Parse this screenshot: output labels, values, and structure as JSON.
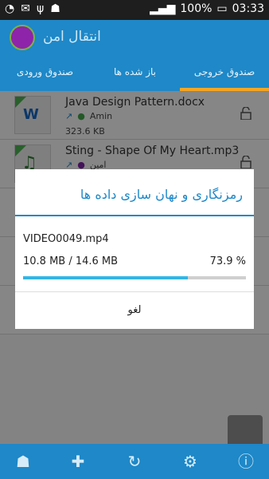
{
  "status_bar": {
    "battery": "100%",
    "time": "03:33"
  },
  "app": {
    "title": "انتقال امن"
  },
  "tabs": [
    {
      "label": "صندوق ورودی"
    },
    {
      "label": "باز شده ها"
    },
    {
      "label": "صندوق خروجی"
    }
  ],
  "files": [
    {
      "name": "Java Design Pattern.docx",
      "contact": "Amin",
      "size": "323.6 KB"
    },
    {
      "name": "Sting - Shape Of My Heart.mp3",
      "contact": "امین"
    }
  ],
  "dialog": {
    "title": "رمزنگاری و نهان سازی داده ها",
    "filename": "VIDEO0049.mp4",
    "sizes": "10.8 MB / 14.6 MB",
    "percent_text": "73.9 %",
    "progress": 0.739,
    "cancel_label": "لغو"
  },
  "bottom_bar": {
    "icons": [
      "android-icon",
      "add-file-icon",
      "refresh-icon",
      "settings-icon",
      "info-icon"
    ]
  },
  "colors": {
    "primary": "#1e88c8",
    "accent": "#f5a623",
    "progress": "#33b5e5"
  }
}
